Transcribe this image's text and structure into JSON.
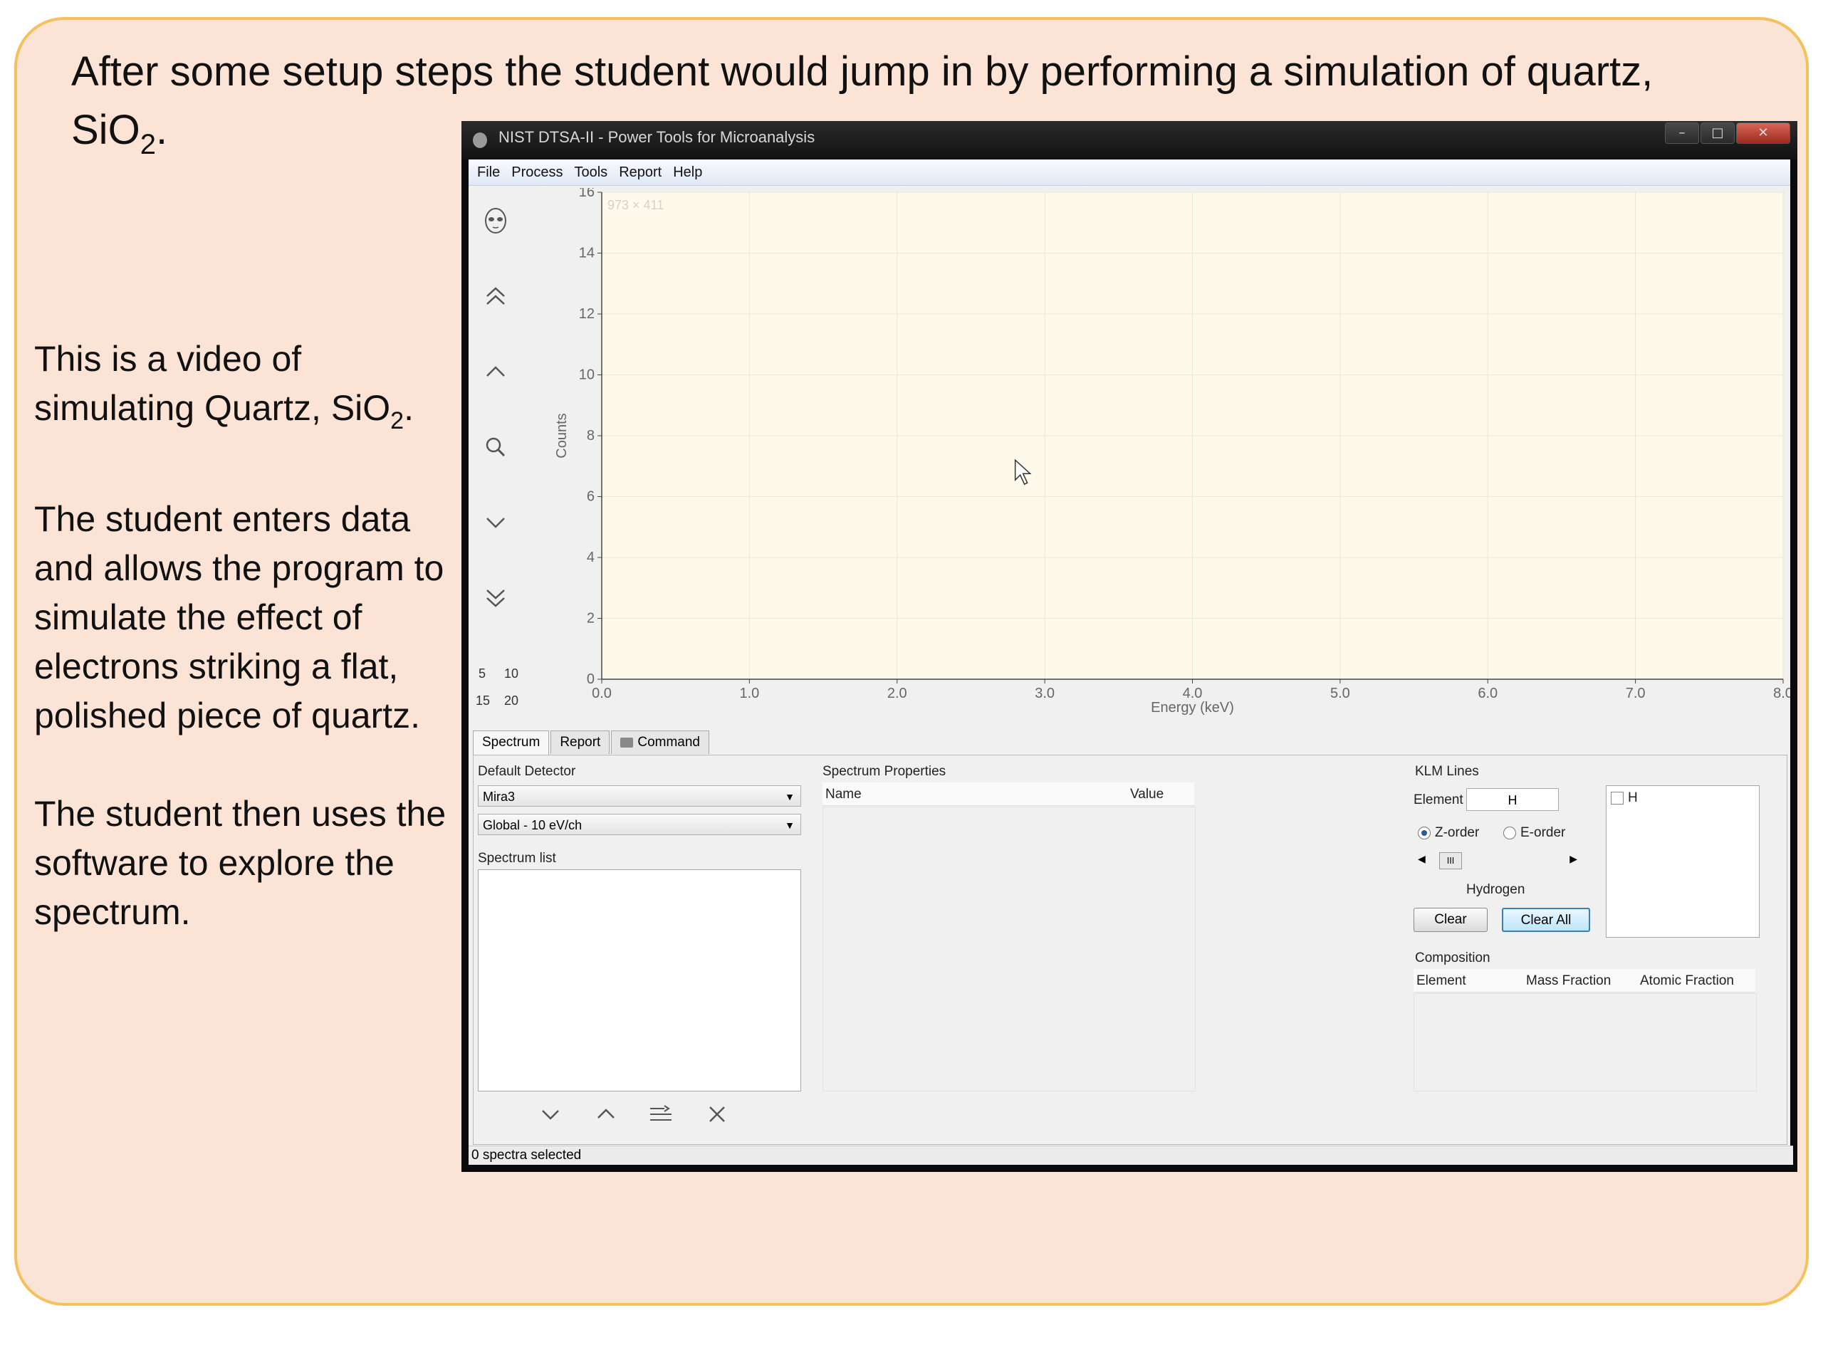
{
  "slide": {
    "title_main": "After some setup steps the student would jump in by performing a simulation of quartz,",
    "title_formula_prefix": "SiO",
    "title_formula_sub": "2",
    "title_formula_suffix": ".",
    "para1_line1": "This is a video of",
    "para1_prefix": "simulating Quartz, SiO",
    "para1_sub": "2",
    "para1_suffix": ".",
    "para2": "The student enters data and allows the program to simulate the effect of electrons striking a flat, polished piece of quartz.",
    "para3": "The student then uses the software to explore the spectrum."
  },
  "window": {
    "title": "NIST DTSA-II - Power Tools for Microanalysis",
    "minimize_glyph": "–",
    "maximize_glyph": "□",
    "close_glyph": "✕"
  },
  "menu": [
    "File",
    "Process",
    "Tools",
    "Report",
    "Help"
  ],
  "toolbar": {
    "icons": [
      "alien-icon",
      "double-chevron-up-icon",
      "chevron-up-icon",
      "search-icon",
      "chevron-down-icon",
      "double-chevron-down-icon"
    ],
    "numbers_row1": [
      "5",
      "10"
    ],
    "numbers_row2": [
      "15",
      "20"
    ]
  },
  "chart_data": {
    "type": "line",
    "title": "",
    "xlabel": "Energy (keV)",
    "ylabel": "Counts",
    "xlim": [
      0,
      8
    ],
    "ylim": [
      0,
      16
    ],
    "x_ticks": [
      "0.0",
      "1.0",
      "2.0",
      "3.0",
      "4.0",
      "5.0",
      "6.0",
      "7.0",
      "8.0"
    ],
    "y_ticks": [
      "0",
      "2",
      "4",
      "6",
      "8",
      "10",
      "12",
      "14",
      "16"
    ],
    "grid": true,
    "series": [],
    "cursor_readout": "973 × 411",
    "background": "#fdfaec"
  },
  "tabs": [
    "Spectrum",
    "Report",
    "Command"
  ],
  "spectrum_panel": {
    "default_detector_label": "Default Detector",
    "detector_value": "Mira3",
    "calibration_value": "Global - 10 eV/ch",
    "spectrum_list_label": "Spectrum list",
    "list_buttons": [
      "chevron-down-icon",
      "chevron-up-icon",
      "list-merge-icon",
      "close-icon"
    ]
  },
  "properties": {
    "label": "Spectrum Properties",
    "col_name": "Name",
    "col_value": "Value"
  },
  "klm": {
    "label": "KLM Lines",
    "element_label": "Element",
    "element_value": "H",
    "z_order": "Z-order",
    "e_order": "E-order",
    "scroll_thumb": "III",
    "element_name": "Hydrogen",
    "clear": "Clear",
    "clear_all": "Clear All",
    "checked_list_item": "H"
  },
  "composition": {
    "label": "Composition",
    "col_element": "Element",
    "col_mass": "Mass Fraction",
    "col_atomic": "Atomic Fraction"
  },
  "status": "0 spectra selected",
  "colors": {
    "slide_bg": "#fbe3d6",
    "slide_border": "#f4c15c",
    "plot_bg": "#fdfaec",
    "focus_blue": "#3c7fb1"
  }
}
